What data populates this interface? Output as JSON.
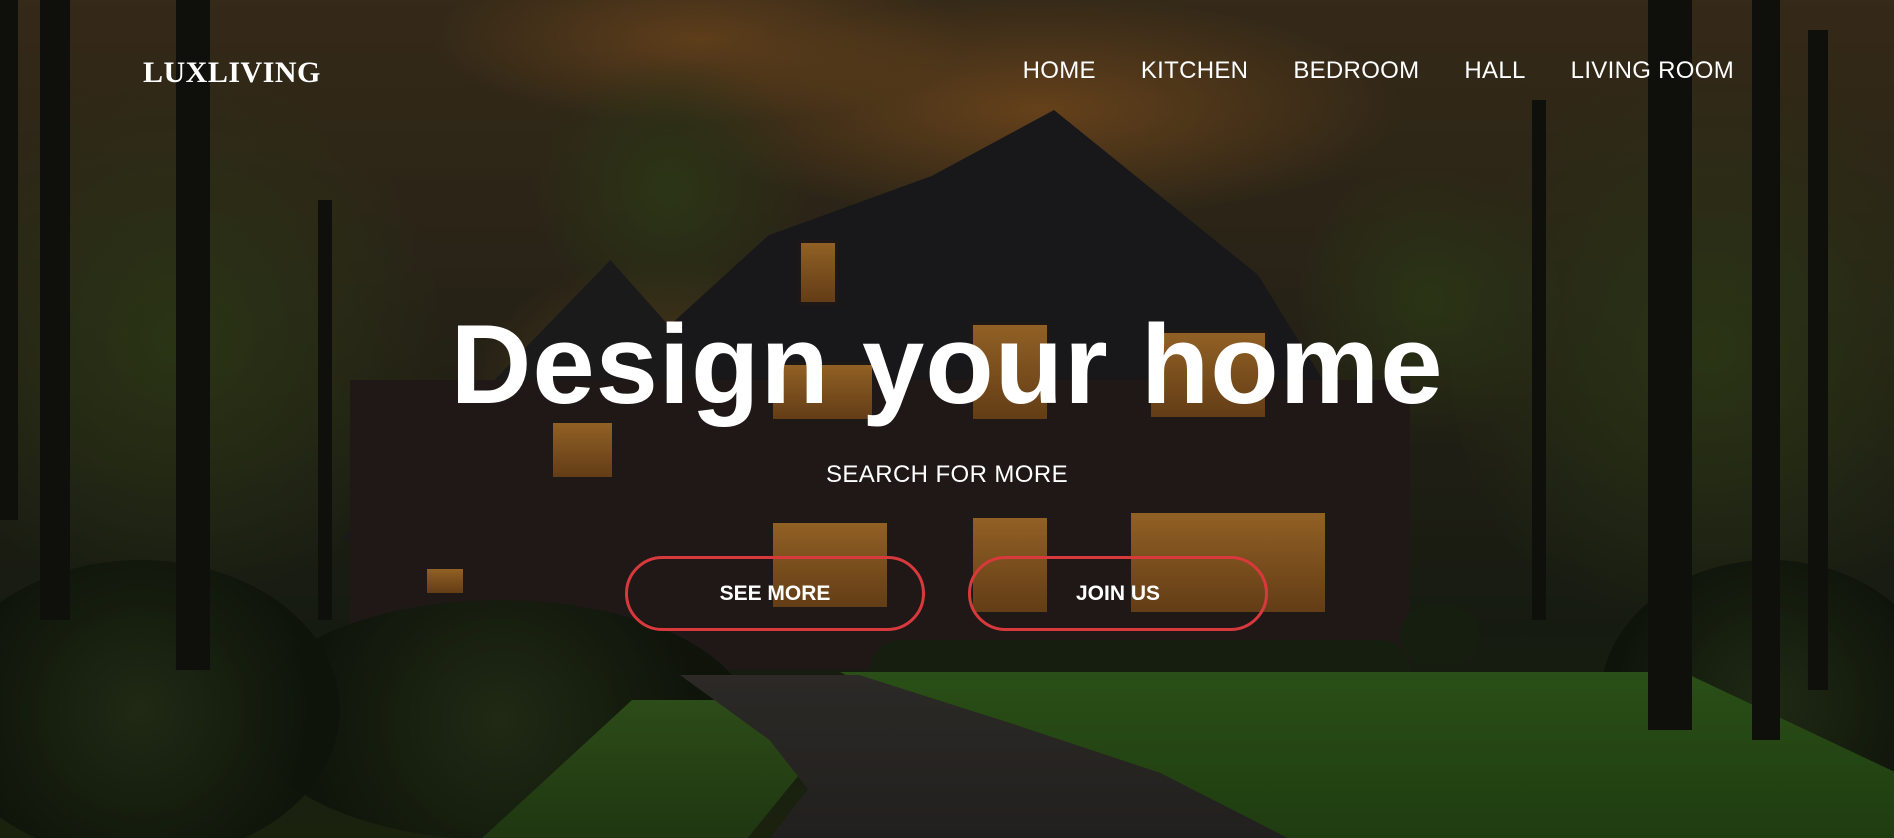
{
  "brand": {
    "logo": "LUXLIVING"
  },
  "nav": {
    "items": [
      {
        "label": "HOME"
      },
      {
        "label": "KITCHEN"
      },
      {
        "label": "BEDROOM"
      },
      {
        "label": "HALL"
      },
      {
        "label": "LIVING ROOM"
      }
    ]
  },
  "hero": {
    "headline": "Design your home",
    "subtitle": "SEARCH FOR MORE",
    "primary_button": "SEE MORE",
    "secondary_button": "JOIN US"
  },
  "colors": {
    "button_border": "#d8393c",
    "text": "#ffffff"
  }
}
